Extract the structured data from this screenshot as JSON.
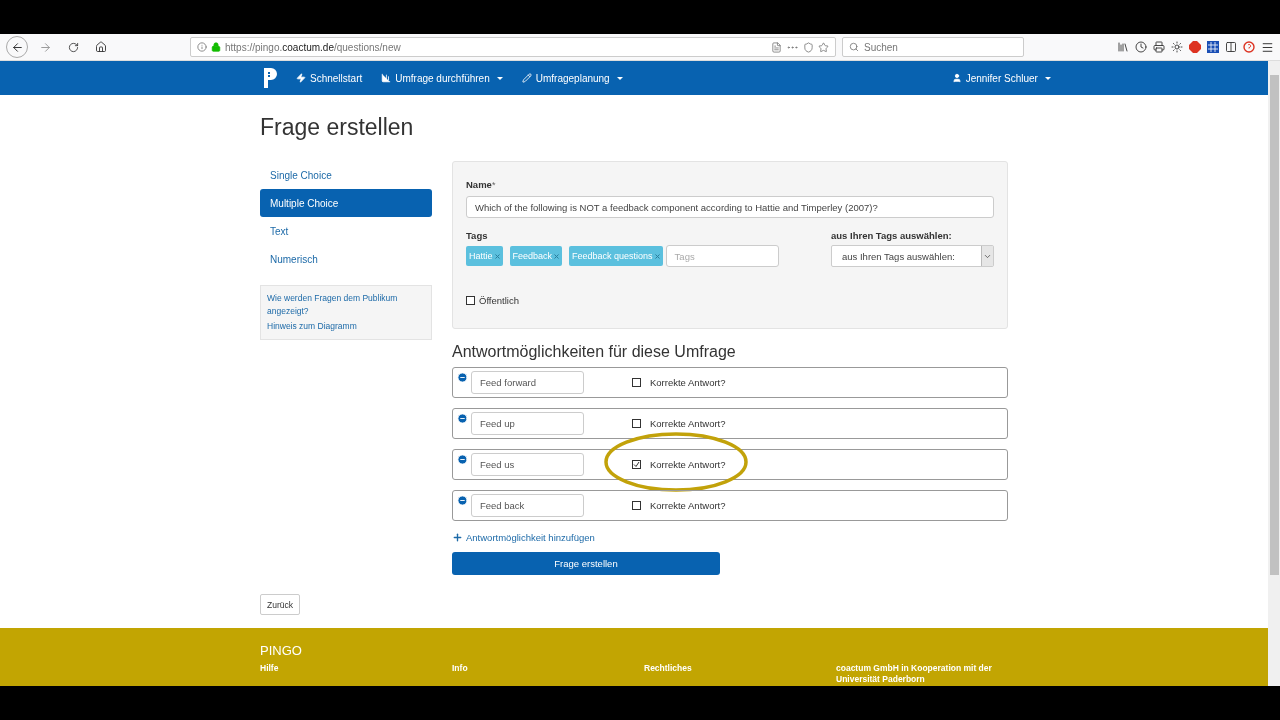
{
  "browser": {
    "url_prefix": "https://pingo.",
    "url_domain": "coactum.de",
    "url_path": "/questions/new",
    "search_placeholder": "Suchen"
  },
  "navbar": {
    "items": [
      {
        "kind": "bolt",
        "label": "Schnellstart",
        "dropdown": false
      },
      {
        "kind": "chart",
        "label": "Umfrage durchführen",
        "dropdown": true
      },
      {
        "kind": "pencil",
        "label": "Umfrageplanung",
        "dropdown": true
      }
    ],
    "user": "Jennifer Schluer"
  },
  "title": "Frage erstellen",
  "sidebar": {
    "items": [
      {
        "label": "Single Choice",
        "selected": false
      },
      {
        "label": "Multiple Choice",
        "selected": true
      },
      {
        "label": "Text",
        "selected": false
      },
      {
        "label": "Numerisch",
        "selected": false
      }
    ],
    "help_links": [
      "Wie werden Fragen dem Publikum angezeigt?",
      "Hinweis zum Diagramm"
    ]
  },
  "form": {
    "name_label": "Name",
    "required_mark": "*",
    "name_value": "Which of the following is NOT a feedback component according to Hattie and Timperley (2007)?",
    "tags_label": "Tags",
    "tags": [
      "Hattie",
      "Feedback",
      "Feedback questions"
    ],
    "tags_placeholder": "Tags",
    "tag_select_label": "aus Ihren Tags auswählen:",
    "tag_select_value": "aus Ihren Tags auswählen:",
    "public_label": "Öffentlich",
    "public_checked": false
  },
  "answers_heading": "Antwortmöglichkeiten für diese Umfrage",
  "answers": [
    {
      "text": "Feed forward",
      "correct_label": "Korrekte Antwort?",
      "checked": false,
      "circled": false
    },
    {
      "text": "Feed up",
      "correct_label": "Korrekte Antwort?",
      "checked": false,
      "circled": false
    },
    {
      "text": "Feed us",
      "correct_label": "Korrekte Antwort?",
      "checked": true,
      "circled": true
    },
    {
      "text": "Feed back",
      "correct_label": "Korrekte Antwort?",
      "checked": false,
      "circled": false
    }
  ],
  "add_answer": "Antwortmöglichkeit hinzufügen",
  "submit": "Frage erstellen",
  "back": "Zurück",
  "footer": {
    "brand": "PINGO",
    "columns": [
      "Hilfe",
      "Info",
      "Rechtliches",
      "coactum GmbH in Kooperation mit der Universität Paderborn"
    ]
  }
}
